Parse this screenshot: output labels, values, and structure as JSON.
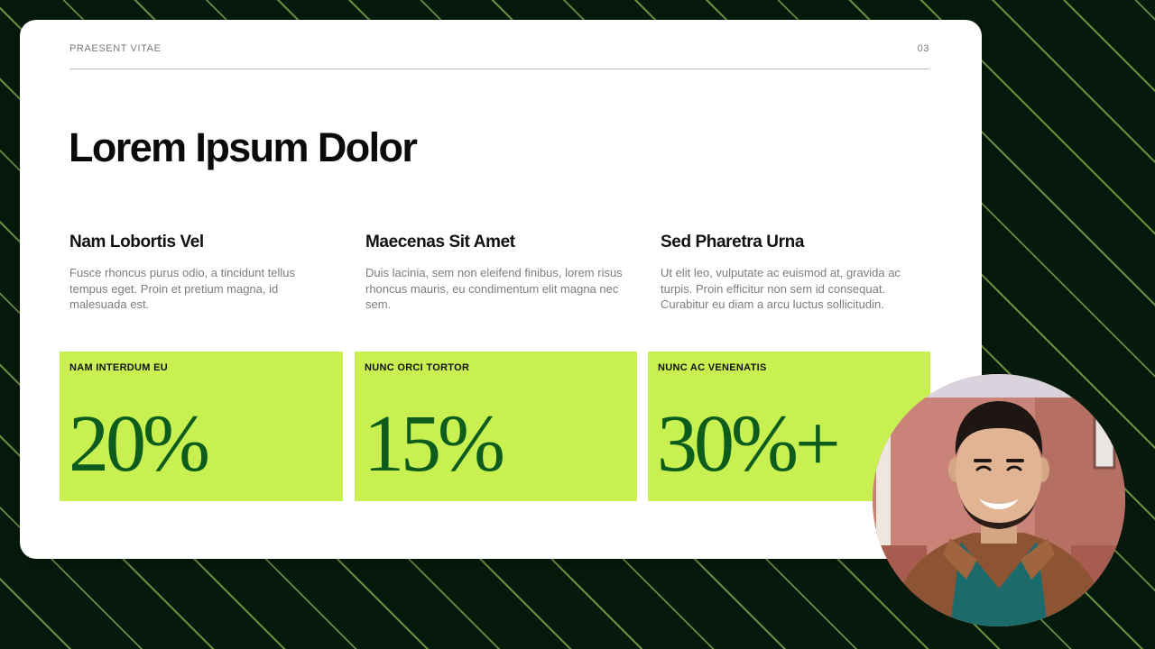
{
  "slide": {
    "eyebrow": "PRAESENT VITAE",
    "page_number": "03",
    "title": "Lorem Ipsum Dolor"
  },
  "columns": [
    {
      "heading": "Nam Lobortis Vel",
      "body": "Fusce rhoncus purus odio, a tincidunt tellus tempus eget. Proin et pretium magna, id malesuada est."
    },
    {
      "heading": "Maecenas Sit Amet",
      "body": "Duis lacinia, sem non eleifend finibus, lorem risus rhoncus mauris, eu condimentum elit magna nec sem."
    },
    {
      "heading": "Sed Pharetra Urna",
      "body": "Ut elit leo, vulputate ac euismod at, gravida ac turpis. Proin efficitur non sem id consequat. Curabitur eu diam a arcu luctus sollicitudin."
    }
  ],
  "stats": [
    {
      "label": "NAM INTERDUM EU",
      "value": "20%"
    },
    {
      "label": "NUNC ORCI TORTOR",
      "value": "15%"
    },
    {
      "label": "NUNC AC VENENATIS",
      "value": "30%+"
    }
  ],
  "colors": {
    "background": "#051a0c",
    "stripe": "#bdeb6e",
    "card": "#ffffff",
    "accent": "#c8f051",
    "stat_text": "#0b5c1d"
  },
  "presenter": {
    "icon": "presenter-avatar"
  }
}
